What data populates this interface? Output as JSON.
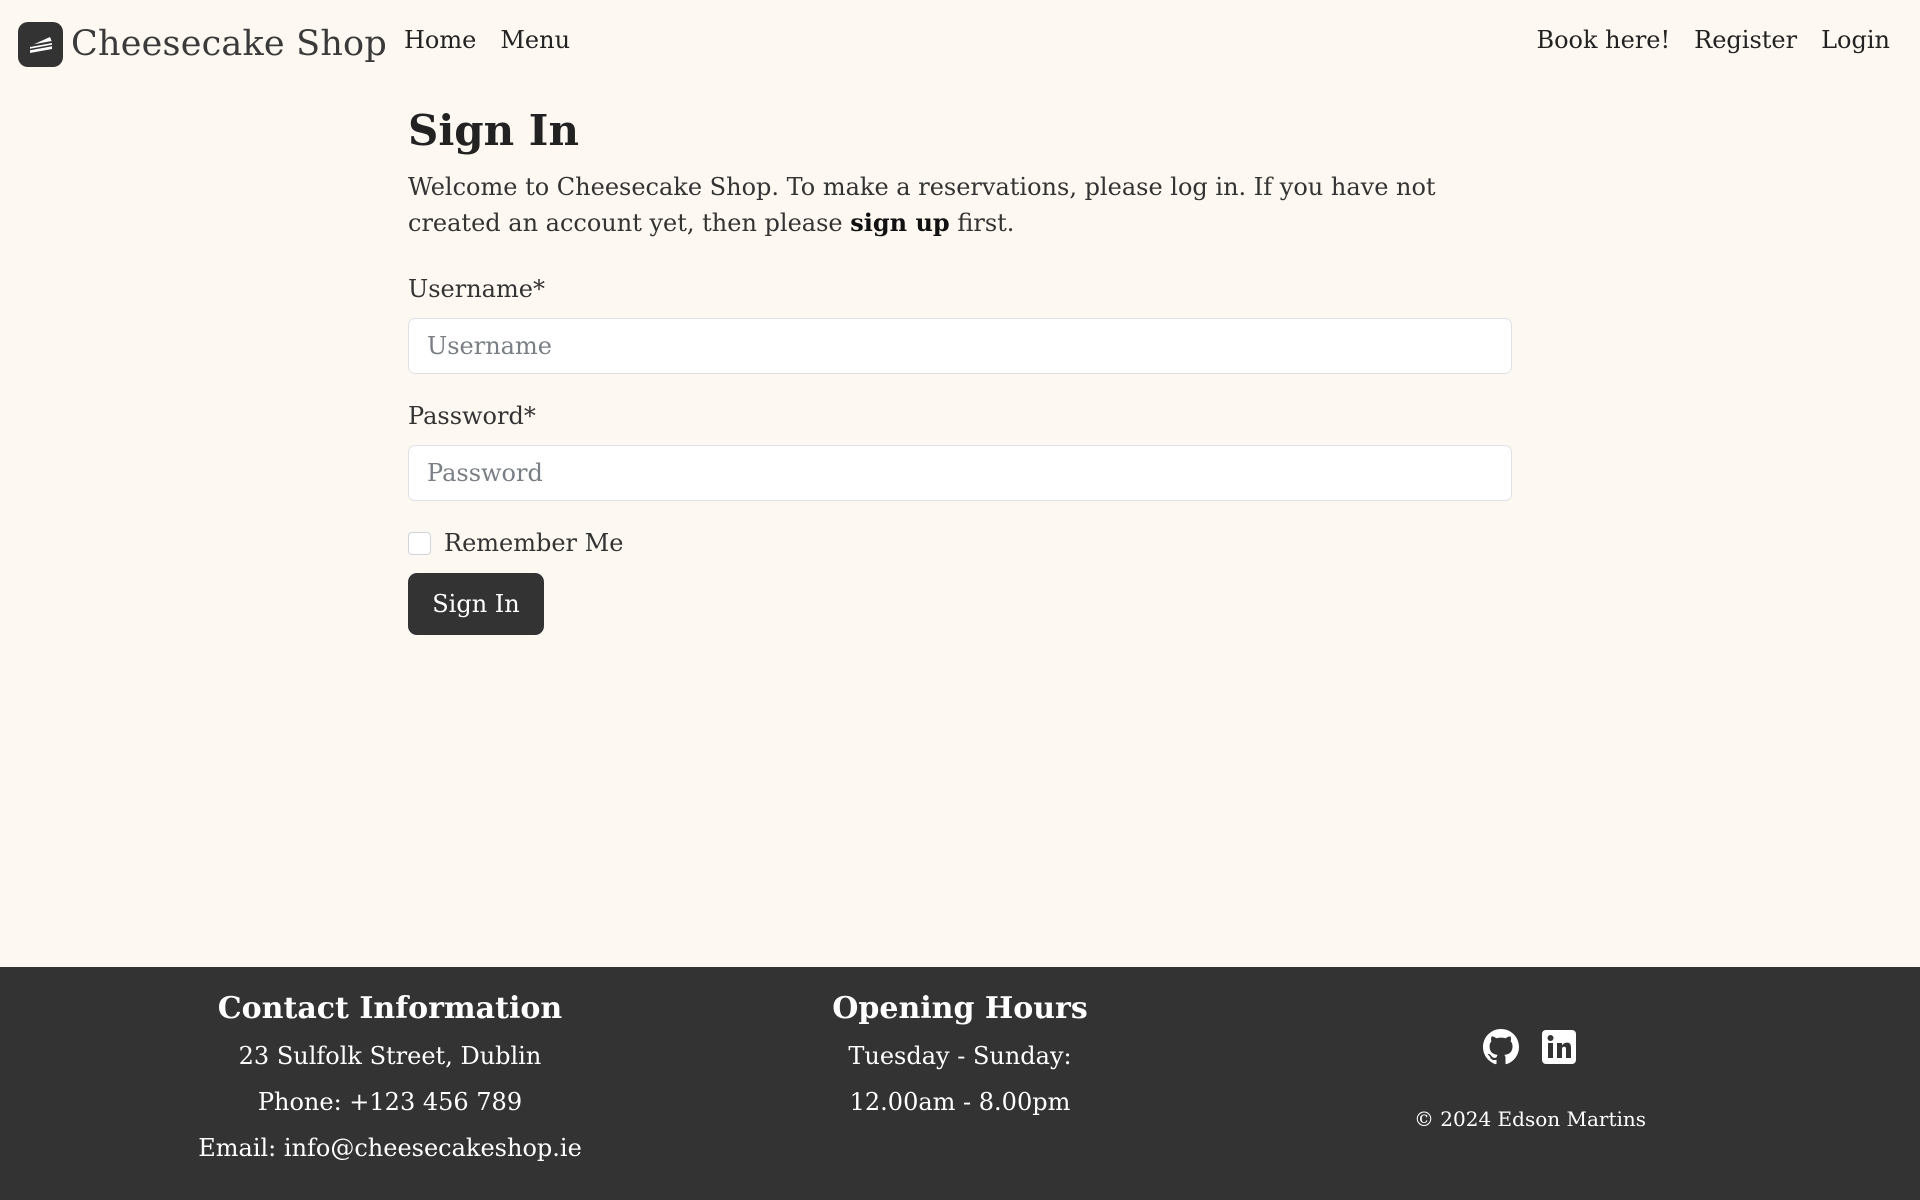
{
  "navbar": {
    "brand": "Cheesecake Shop",
    "links_left": [
      "Home",
      "Menu"
    ],
    "links_right": [
      "Book here!",
      "Register",
      "Login"
    ]
  },
  "page": {
    "title": "Sign In",
    "intro_before": "Welcome to Cheesecake Shop. To make a reservations, please log in. If you have not created an account yet, then please",
    "intro_link": "sign up",
    "intro_after": "first."
  },
  "form": {
    "username_label": "Username*",
    "username_placeholder": "Username",
    "password_label": "Password*",
    "password_placeholder": "Password",
    "remember_label": "Remember Me",
    "remember_checked": false,
    "submit_label": "Sign In"
  },
  "footer": {
    "contact_title": "Contact Information",
    "address": "23 Sulfolk Street, Dublin",
    "phone": "Phone: +123 456 789",
    "email": "Email: info@cheesecakeshop.ie",
    "hours_title": "Opening Hours",
    "hours_days": "Tuesday - Sunday:",
    "hours_times": "12.00am - 8.00pm",
    "social_icons": [
      "github-icon",
      "linkedin-icon"
    ],
    "copyright": "© 2024 Edson Martins"
  },
  "colors": {
    "background": "#fdf8f1",
    "dark": "#333333"
  }
}
